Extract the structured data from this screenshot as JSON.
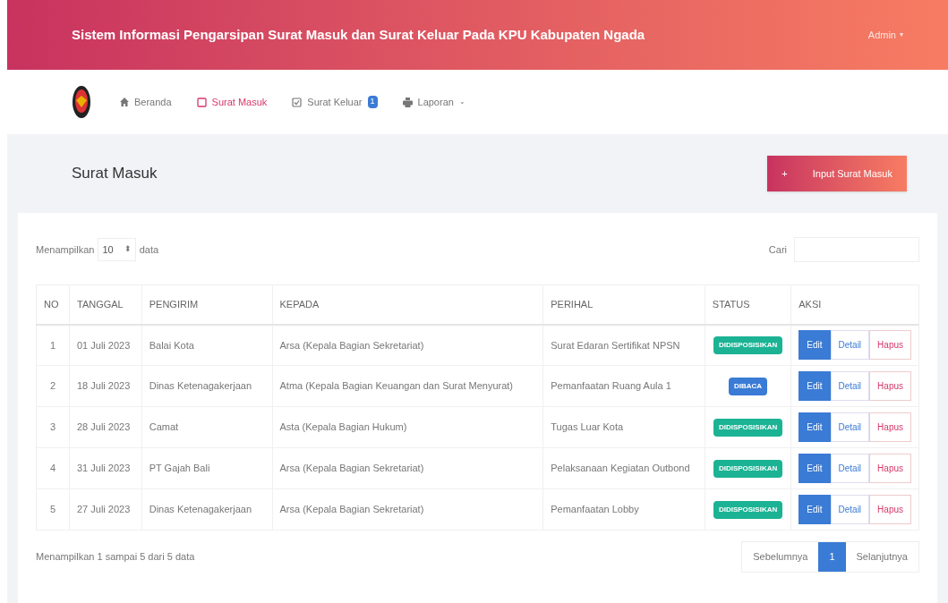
{
  "header": {
    "title": "Sistem Informasi Pengarsipan Surat Masuk dan Surat Keluar Pada KPU Kabupaten Ngada",
    "user_menu": "Admin",
    "user_caret": "▾"
  },
  "nav": [
    {
      "label": "Beranda",
      "selected": false
    },
    {
      "label": "Surat Masuk",
      "selected": true
    },
    {
      "label": "Surat Keluar",
      "selected": false,
      "badge": "1"
    },
    {
      "label": "Laporan",
      "selected": false,
      "caret": "⌄"
    }
  ],
  "page": {
    "title": "Surat Masuk",
    "add_button": "Input Surat Masuk",
    "add_icon": "+"
  },
  "table_controls": {
    "show_label": "Menampilkan",
    "page_size": "10",
    "select_arrow": "⬍",
    "show_suffix": "data",
    "search_label": "Cari"
  },
  "table": {
    "columns": [
      "NO",
      "TANGGAL",
      "PENGIRIM",
      "KEPADA",
      "PERIHAL",
      "STATUS",
      "AKSI"
    ],
    "rows": [
      {
        "no": "1",
        "tanggal": "01 Juli 2023",
        "pengirim": "Balai Kota",
        "kepada": "Arsa (Kepala Bagian Sekretariat)",
        "perihal": "Surat Edaran Sertifikat NPSN",
        "status": {
          "kind": "disposisi",
          "label": "DIDISPOSISIKAN"
        },
        "actions": [
          "Edit",
          "Detail",
          "Hapus"
        ]
      },
      {
        "no": "2",
        "tanggal": "18 Juli 2023",
        "pengirim": "Dinas Ketenagakerjaan",
        "kepada": "Atma (Kepala Bagian Keuangan dan Surat Menyurat)",
        "perihal": "Pemanfaatan Ruang Aula 1",
        "status": {
          "kind": "dibaca",
          "label": "DIBACA"
        },
        "actions": [
          "Edit",
          "Detail",
          "Hapus"
        ]
      },
      {
        "no": "3",
        "tanggal": "28 Juli 2023",
        "pengirim": "Camat",
        "kepada": "Asta (Kepala Bagian Hukum)",
        "perihal": "Tugas Luar Kota",
        "status": {
          "kind": "disposisi",
          "label": "DIDISPOSISIKAN"
        },
        "actions": [
          "Edit",
          "Detail",
          "Hapus"
        ]
      },
      {
        "no": "4",
        "tanggal": "31 Juli 2023",
        "pengirim": "PT Gajah Bali",
        "kepada": "Arsa (Kepala Bagian Sekretariat)",
        "perihal": "Pelaksanaan Kegiatan Outbond",
        "status": {
          "kind": "disposisi",
          "label": "DIDISPOSISIKAN"
        },
        "actions": [
          "Edit",
          "Detail",
          "Hapus"
        ]
      },
      {
        "no": "5",
        "tanggal": "27 Juli 2023",
        "pengirim": "Dinas Ketenagakerjaan",
        "kepada": "Arsa (Kepala Bagian Sekretariat)",
        "perihal": "Pemanfaatan Lobby",
        "status": {
          "kind": "disposisi",
          "label": "DIDISPOSISIKAN"
        },
        "actions": [
          "Edit",
          "Detail",
          "Hapus"
        ]
      }
    ]
  },
  "footer": {
    "info": "Menampilkan 1 sampai 5 dari 5 data",
    "pagination": [
      {
        "label": "Sebelumnya",
        "selected": false
      },
      {
        "label": "1",
        "selected": true
      },
      {
        "label": "Selanjutnya",
        "selected": false
      }
    ]
  }
}
